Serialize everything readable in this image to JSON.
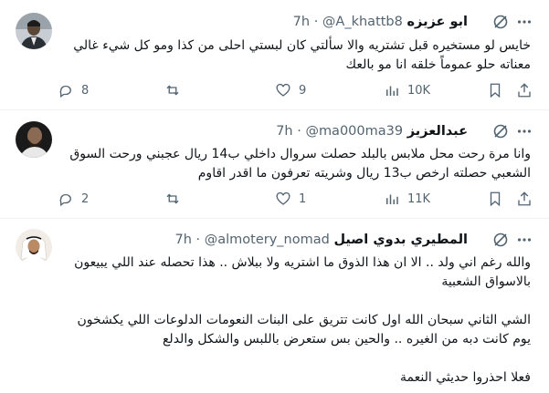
{
  "tweets": [
    {
      "name": "ابو عزيزه",
      "handle": "@A_khattb8",
      "sep": "·",
      "time": "7h",
      "lines": [
        "خايس لو مستخيره قبل تشتريه والا سألتي كان لبستي احلى من كذا ومو كل شيء غالي",
        "معناته حلو عموماً خلقه انا مو بالعك"
      ],
      "replies": "8",
      "reposts": "",
      "likes": "9",
      "views": "10K"
    },
    {
      "name": "عبدالعزيز",
      "handle": "@ma000ma39",
      "sep": "·",
      "time": "7h",
      "lines": [
        "وانا مرة رحت محل ملابس بالبلد حصلت سروال داخلي ب14 ريال عجبني ورحت السوق",
        "الشعبي حصلته ارخص ب13 ريال وشريته تعرفون ما اقدر اقاوم"
      ],
      "replies": "2",
      "reposts": "",
      "likes": "1",
      "views": "11K"
    },
    {
      "name": "المطيري بدوي اصيل",
      "handle": "@almotery_nomad",
      "sep": "·",
      "time": "7h",
      "lines": [
        "والله رغم اني ولد .. الا ان هذا الذوق ما اشتريه ولا ببلاش .. هذا تحصله عند اللي يبيعون",
        "بالاسواق الشعبية",
        "",
        "الشي الثاني سبحان الله اول كانت تتريق على البنات النعومات الدلوعات اللي يكشخون",
        "يوم كانت دبه من الغيره .. والحين بس ستعرض باللبس والشكل والدلع",
        "",
        "فعلا احذروا حديثي النعمة"
      ]
    }
  ]
}
